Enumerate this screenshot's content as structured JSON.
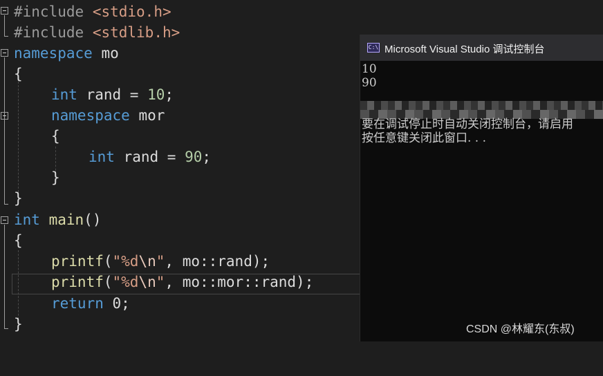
{
  "editor": {
    "lines": [
      {
        "parts": [
          "#include",
          " ",
          "<stdio.h>"
        ]
      },
      {
        "parts": [
          "#include",
          " ",
          "<stdlib.h>"
        ]
      },
      {
        "parts": [
          "namespace",
          " mo"
        ]
      },
      {
        "parts": [
          "{"
        ]
      },
      {
        "parts": [
          "int",
          " rand = ",
          "10",
          ";"
        ]
      },
      {
        "parts": [
          "namespace",
          " mor"
        ]
      },
      {
        "parts": [
          "{"
        ]
      },
      {
        "parts": [
          "int",
          " rand = ",
          "90",
          ";"
        ]
      },
      {
        "parts": [
          "}"
        ]
      },
      {
        "parts": [
          "}"
        ]
      },
      {
        "parts": [
          "int",
          " ",
          "main",
          "()"
        ]
      },
      {
        "parts": [
          "{"
        ]
      },
      {
        "parts": [
          "printf",
          "(",
          "\"%d",
          "\\n",
          "\"",
          ", mo::rand);"
        ]
      },
      {
        "parts": [
          "printf",
          "(",
          "\"%d",
          "\\n",
          "\"",
          ", mo::mor::rand);"
        ]
      },
      {
        "parts": [
          "return",
          " 0;"
        ]
      },
      {
        "parts": [
          "}"
        ]
      }
    ]
  },
  "console": {
    "title": "Microsoft Visual Studio 调试控制台",
    "icon": "console-app-icon",
    "icon_glyph": "C:\\",
    "output": [
      "10",
      "90"
    ],
    "message_line_1": "要在调试停止时自动关闭控制台，请启用",
    "message_line_2": "按任意键关闭此窗口. . ."
  },
  "watermark": "CSDN @林耀东(东叔)",
  "colors": {
    "keyword": "#569cd6",
    "string": "#d69d85",
    "number": "#b5cea8",
    "function": "#dcdcaa",
    "background": "#1e1e1e"
  }
}
